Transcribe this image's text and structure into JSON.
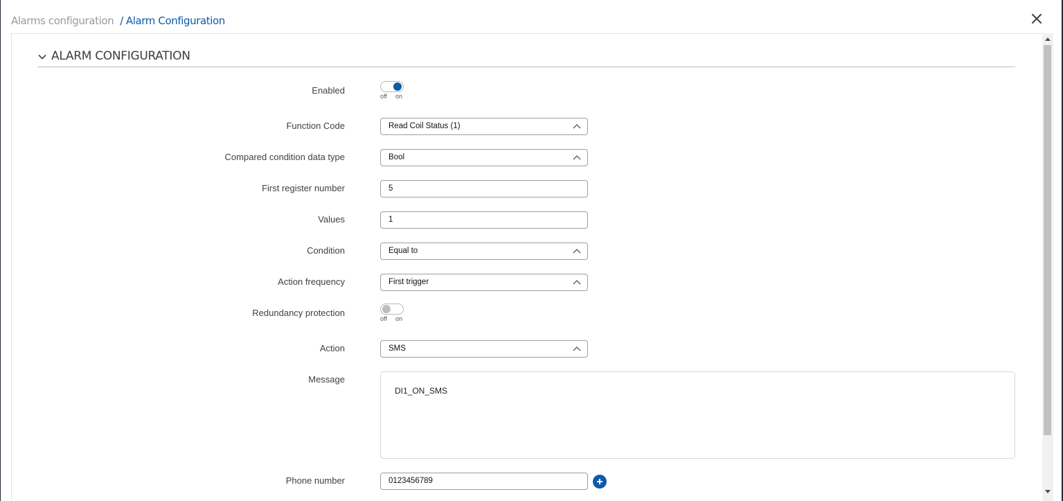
{
  "breadcrumb": {
    "parent": "Alarms configuration",
    "separator": "/",
    "current": "Alarm Configuration"
  },
  "section": {
    "title": "ALARM CONFIGURATION"
  },
  "form": {
    "enabled": {
      "label": "Enabled",
      "value": "on",
      "off_label": "off",
      "on_label": "on"
    },
    "function_code": {
      "label": "Function Code",
      "value": "Read Coil Status (1)"
    },
    "data_type": {
      "label": "Compared condition data type",
      "value": "Bool"
    },
    "first_register": {
      "label": "First register number",
      "value": "5"
    },
    "values": {
      "label": "Values",
      "value": "1"
    },
    "condition": {
      "label": "Condition",
      "value": "Equal to"
    },
    "action_frequency": {
      "label": "Action frequency",
      "value": "First trigger"
    },
    "redundancy": {
      "label": "Redundancy protection",
      "value": "off",
      "off_label": "off",
      "on_label": "on"
    },
    "action": {
      "label": "Action",
      "value": "SMS"
    },
    "message": {
      "label": "Message",
      "value": "DI1_ON_SMS"
    },
    "phone": {
      "label": "Phone number",
      "value": "0123456789"
    }
  },
  "colors": {
    "accent": "#0e5ba8",
    "border": "#9e9e9e",
    "muted": "#9a9a9a"
  }
}
